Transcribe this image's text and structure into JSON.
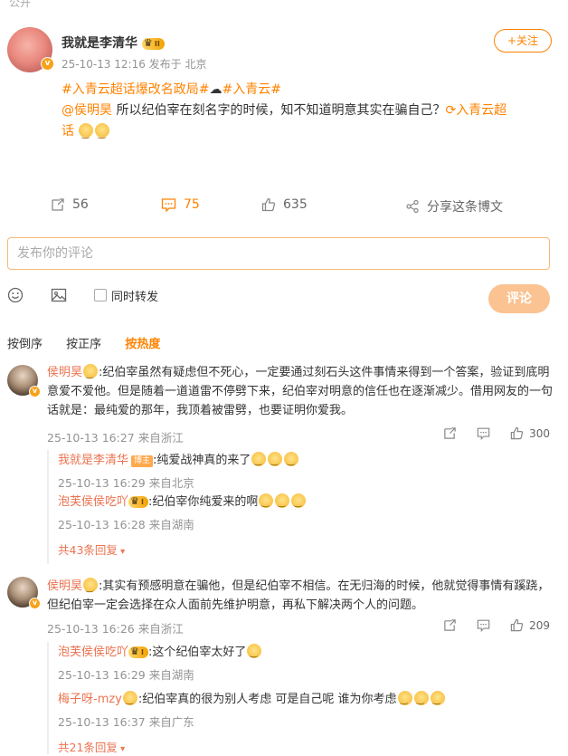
{
  "top_label": "公开",
  "post": {
    "author": "我就是李清华",
    "level": "II",
    "follow_label": "+关注",
    "meta": "25-10-13 12:16  发布于 北京",
    "tags_line": "#入青云超话爆改名政局#",
    "tag2": "#入青云#",
    "mention": "@侯明昊",
    "text": " 所以纪伯宰在刻名字的时候，知不知道明意其实在骗自己？",
    "supertopic": "入青云超",
    "supertopic_end": "话"
  },
  "actions": {
    "repost": "56",
    "comment": "75",
    "like": "635",
    "share": "分享这条博文"
  },
  "comment_input": {
    "placeholder": "发布你的评论"
  },
  "tools": {
    "repost_label": "同时转发",
    "submit_label": "评论"
  },
  "sort": [
    "按倒序",
    "按正序",
    "按热度"
  ],
  "comments": [
    {
      "user": "侯明昊",
      "text": ":纪伯宰虽然有疑虑但不死心，一定要通过刻石头这件事情来得到一个答案，验证到底明意爱不爱他。但是随着一道道雷不停劈下来，纪伯宰对明意的信任也在逐渐减少。借用网友的一句话就是：最纯爱的那年，我顶着被雷劈，也要证明你爱我。",
      "meta": "25-10-13 16:27  来自浙江",
      "likes": "300",
      "replies": [
        {
          "user": "我就是李清华",
          "badge": "博主",
          "text": ":纯爱战神真的来了",
          "meta": "25-10-13 16:29  来自北京"
        },
        {
          "user": "泡芙侯侯吃吖",
          "level": "I",
          "text": ":纪伯宰你纯爱来的啊",
          "meta": "25-10-13 16:28  来自湖南"
        }
      ],
      "more": "共43条回复"
    },
    {
      "user": "侯明昊",
      "text": ":其实有预感明意在骗他，但是纪伯宰不相信。在无归海的时候，他就觉得事情有蹊跷，但纪伯宰一定会选择在众人面前先维护明意，再私下解决两个人的问题。",
      "meta": "25-10-13 16:26  来自浙江",
      "likes": "209",
      "replies": [
        {
          "user": "泡芙侯侯吃吖",
          "level": "I",
          "text": ":这个纪伯宰太好了",
          "meta": "25-10-13 16:29  来自湖南"
        },
        {
          "user": "梅子呀-mzy",
          "text": ":纪伯宰真的很为别人考虑 可是自己呢 谁为你考虑",
          "meta": "25-10-13 16:37  来自广东"
        }
      ],
      "more": "共21条回复"
    }
  ]
}
